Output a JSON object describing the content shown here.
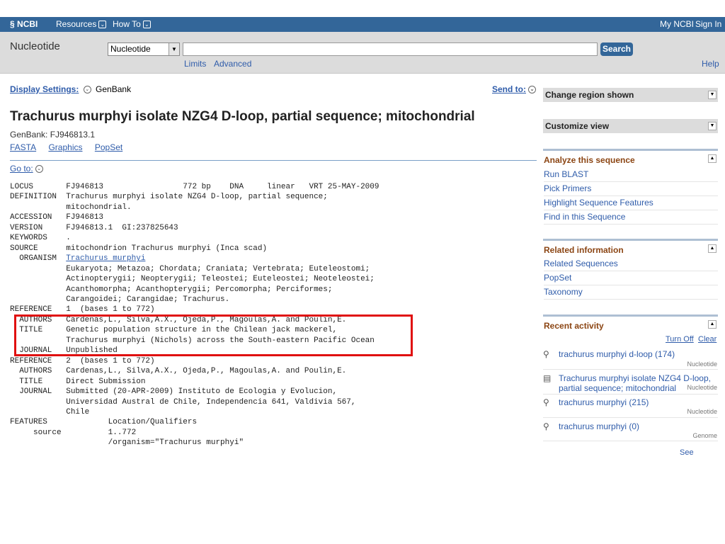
{
  "header": {
    "logo": "NCBI",
    "resources": "Resources",
    "howto": "How To",
    "my_ncbi": "My NCBI",
    "sign_in": "Sign In"
  },
  "search": {
    "db_name": "Nucleotide",
    "db_select": "Nucleotide",
    "query": "",
    "button": "Search",
    "limits": "Limits",
    "advanced": "Advanced",
    "help": "Help"
  },
  "display": {
    "label": "Display Settings:",
    "value": "GenBank",
    "send_to": "Send to:"
  },
  "record_title": "Trachurus murphyi isolate NZG4 D-loop, partial sequence; mitochondrial",
  "accession_line": "GenBank: FJ946813.1",
  "tabs": [
    "FASTA",
    "Graphics",
    "PopSet"
  ],
  "goto": "Go to:",
  "genbank": {
    "part1": "LOCUS       FJ946813                 772 bp    DNA     linear   VRT 25-MAY-2009\nDEFINITION  Trachurus murphyi isolate NZG4 D-loop, partial sequence;\n            mitochondrial.\nACCESSION   FJ946813\nVERSION     FJ946813.1  GI:237825643\nKEYWORDS    .\nSOURCE      mitochondrion Trachurus murphyi (Inca scad)\n  ORGANISM  ",
    "organism": "Trachurus murphyi",
    "part2": "\n            Eukaryota; Metazoa; Chordata; Craniata; Vertebrata; Euteleostomi;\n            Actinopterygii; Neopterygii; Teleostei; Euteleostei; Neoteleostei;\n            Acanthomorpha; Acanthopterygii; Percomorpha; Perciformes;\n            Carangoidei; Carangidae; Trachurus.\nREFERENCE   1  (bases 1 to 772)\n  AUTHORS   Cardenas,L., Silva,A.X., Ojeda,P., Magoulas,A. and Poulin,E.\n  TITLE     Genetic population structure in the Chilean jack mackerel,\n            Trachurus murphyi (Nichols) across the South-eastern Pacific Ocean\n  JOURNAL   Unpublished\nREFERENCE   2  (bases 1 to 772)\n  AUTHORS   Cardenas,L., Silva,A.X., Ojeda,P., Magoulas,A. and Poulin,E.\n  TITLE     Direct Submission\n  JOURNAL   Submitted (20-APR-2009) Instituto de Ecologia y Evolucion,\n            Universidad Austral de Chile, Independencia 641, Valdivia 567,\n            Chile\nFEATURES             Location/Qualifiers\n     source          1..772\n                     /organism=\"Trachurus murphyi\""
  },
  "sidebar": {
    "change_region": "Change region shown",
    "customize_view": "Customize view",
    "analyze": {
      "title": "Analyze this sequence",
      "items": [
        "Run BLAST",
        "Pick Primers",
        "Highlight Sequence Features",
        "Find in this Sequence"
      ]
    },
    "related": {
      "title": "Related information",
      "items": [
        "Related Sequences",
        "PopSet",
        "Taxonomy"
      ]
    },
    "recent": {
      "title": "Recent activity",
      "turn_off": "Turn Off",
      "clear": "Clear",
      "items": [
        {
          "text": "trachurus murphyi d-loop (174)",
          "db": "Nucleotide",
          "icon": "search-icon"
        },
        {
          "text": "Trachurus murphyi isolate NZG4 D-loop, partial sequence; mitochondrial",
          "db": "Nucleotide",
          "icon": "document-icon"
        },
        {
          "text": "trachurus murphyi (215)",
          "db": "Nucleotide",
          "icon": "search-icon"
        },
        {
          "text": "trachurus murphyi (0)",
          "db": "Genome",
          "icon": "search-icon"
        }
      ],
      "see_more": "See more..."
    }
  },
  "colors": {
    "header_bar": "#336699",
    "link": "#2f5caa",
    "highlight_box": "#e01010",
    "panel_title": "#8b4513"
  }
}
